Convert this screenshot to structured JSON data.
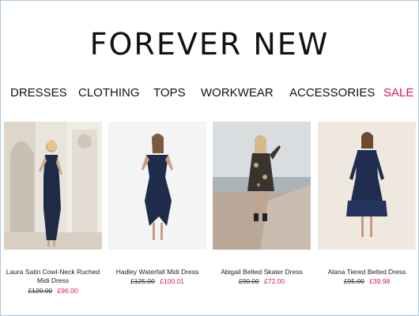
{
  "brand": {
    "logo_text": "FOREVER NEW"
  },
  "nav": {
    "items": [
      {
        "label": "DRESSES"
      },
      {
        "label": "CLOTHING"
      },
      {
        "label": "TOPS"
      },
      {
        "label": "WORKWEAR"
      },
      {
        "label": "ACCESSORIES"
      },
      {
        "label": "SALE"
      }
    ]
  },
  "products": [
    {
      "name_line1": "Laura Satin Cowl-Neck Ruched",
      "name_line2": "Midi Dress",
      "old_price": "£120.00",
      "new_price": "£96.00"
    },
    {
      "name_line1": "Hadley Waterfall Midi Dress",
      "name_line2": "",
      "old_price": "£125.00",
      "new_price": "£100.01"
    },
    {
      "name_line1": "Abigail Belted Skater Dress",
      "name_line2": "",
      "old_price": "£90.00",
      "new_price": "£72.00"
    },
    {
      "name_line1": "Alana Tiered Belted Dress",
      "name_line2": "",
      "old_price": "£95.00",
      "new_price": "£39.98"
    }
  ],
  "colors": {
    "sale": "#d6174f",
    "text": "#111111",
    "frame": "#a9c6dc"
  }
}
